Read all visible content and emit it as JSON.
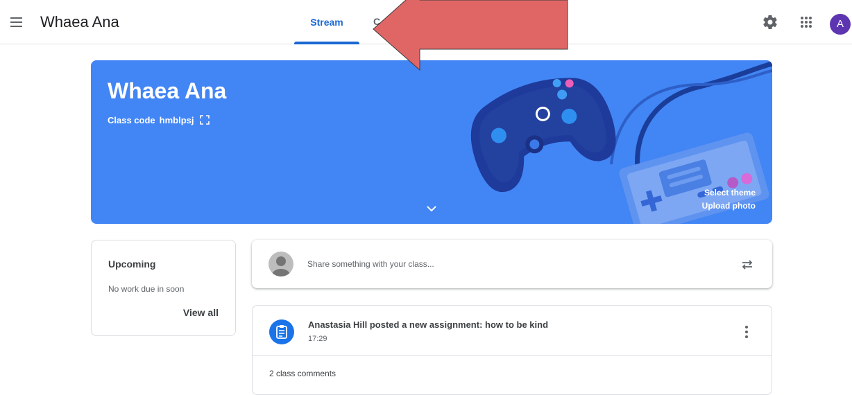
{
  "header": {
    "class_name": "Whaea Ana",
    "tabs": [
      {
        "label": "Stream",
        "selected": true
      },
      {
        "label": "C",
        "selected": false
      }
    ],
    "avatar_letter": "A",
    "icons": [
      "menu-icon",
      "gear-icon",
      "apps-grid-icon"
    ]
  },
  "banner": {
    "title": "Whaea Ana",
    "class_code_label": "Class code",
    "class_code": "hmblpsj",
    "select_theme": "Select theme",
    "upload_photo": "Upload photo",
    "theme_color": "#4285f4"
  },
  "upcoming": {
    "title": "Upcoming",
    "empty_text": "No work due in soon",
    "view_all": "View all"
  },
  "share": {
    "placeholder": "Share something with your class..."
  },
  "posts": [
    {
      "title": "Anastasia Hill posted a new assignment: how to be kind",
      "time": "17:29",
      "comments": "2 class comments"
    }
  ],
  "colors": {
    "accent": "#1967d2",
    "annotation_arrow": "#e06666"
  }
}
